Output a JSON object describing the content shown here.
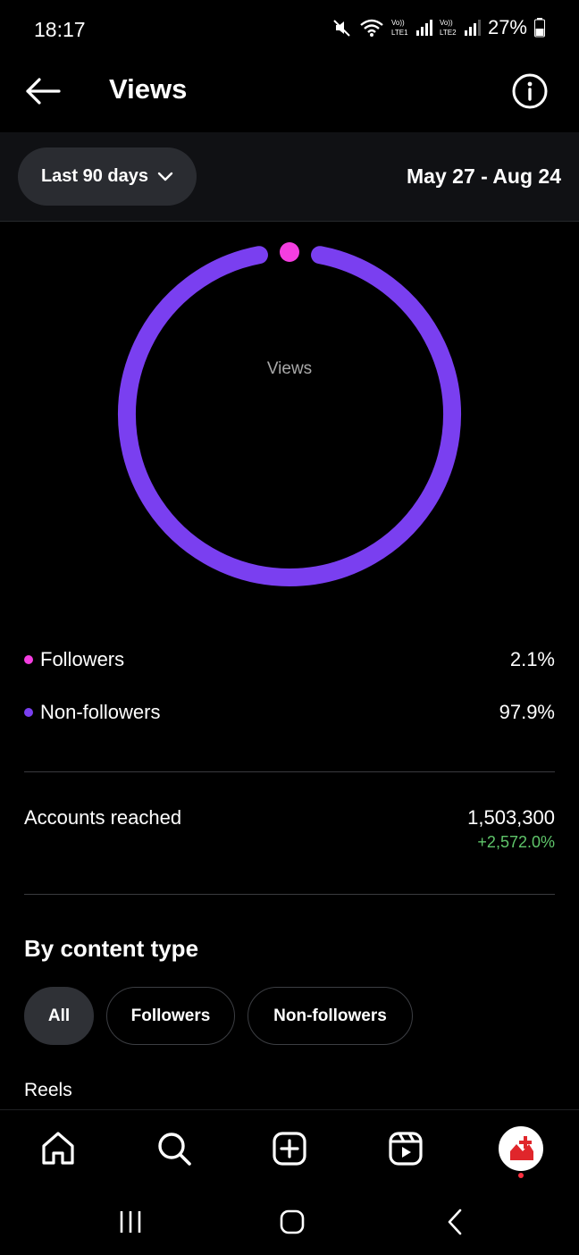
{
  "status_bar": {
    "time": "18:17",
    "battery": "27%",
    "icons": [
      "mute-icon",
      "wifi-icon",
      "lte1-signal-icon",
      "lte2-signal-icon",
      "battery-icon"
    ]
  },
  "header": {
    "title": "Views",
    "back_icon": "arrow-left-icon",
    "info_icon": "info-icon"
  },
  "filter": {
    "range_label": "Last 90 days",
    "date_range": "May 27 - Aug 24"
  },
  "donut": {
    "center_label": "Views",
    "colors": {
      "followers": "#f43ee0",
      "non_followers": "#7a3ff0"
    }
  },
  "chart_data": {
    "type": "pie",
    "categories": [
      "Followers",
      "Non-followers"
    ],
    "values": [
      2.1,
      97.9
    ],
    "title": ""
  },
  "legend": [
    {
      "label": "Followers",
      "value": "2.1%",
      "color": "#f43ee0"
    },
    {
      "label": "Non-followers",
      "value": "97.9%",
      "color": "#7a3ff0"
    }
  ],
  "accounts_reached": {
    "label": "Accounts reached",
    "value": "1,503,300",
    "change": "+2,572.0%",
    "change_color": "#5fc56a"
  },
  "content_type": {
    "title": "By content type",
    "chips": [
      "All",
      "Followers",
      "Non-followers"
    ],
    "selected": "All",
    "first_item": "Reels"
  },
  "bottom_nav": {
    "items": [
      "home-icon",
      "search-icon",
      "create-icon",
      "reels-icon",
      "profile-avatar"
    ]
  },
  "system_nav": {
    "items": [
      "recents-icon",
      "home-icon",
      "back-icon"
    ]
  }
}
